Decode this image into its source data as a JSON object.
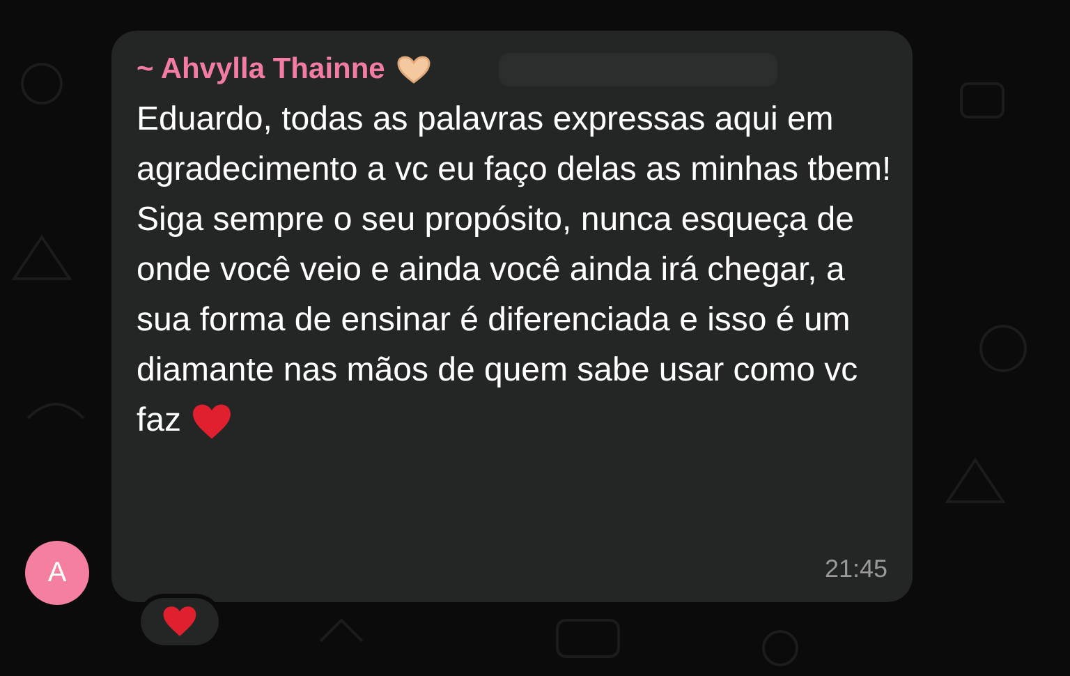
{
  "message": {
    "sender": "~ Ahvylla Thainne",
    "paragraphs": [
      "Eduardo, todas as palavras expressas aqui em agradecimento a vc eu faço delas as minhas tbem!",
      "Siga sempre o seu propósito, nunca esqueça de onde você veio e ainda você ainda irá chegar, a sua forma de ensinar é diferenciada e isso é um diamante nas mãos de quem sabe usar como vc faz"
    ],
    "time": "21:45",
    "avatar_letter": "A"
  }
}
